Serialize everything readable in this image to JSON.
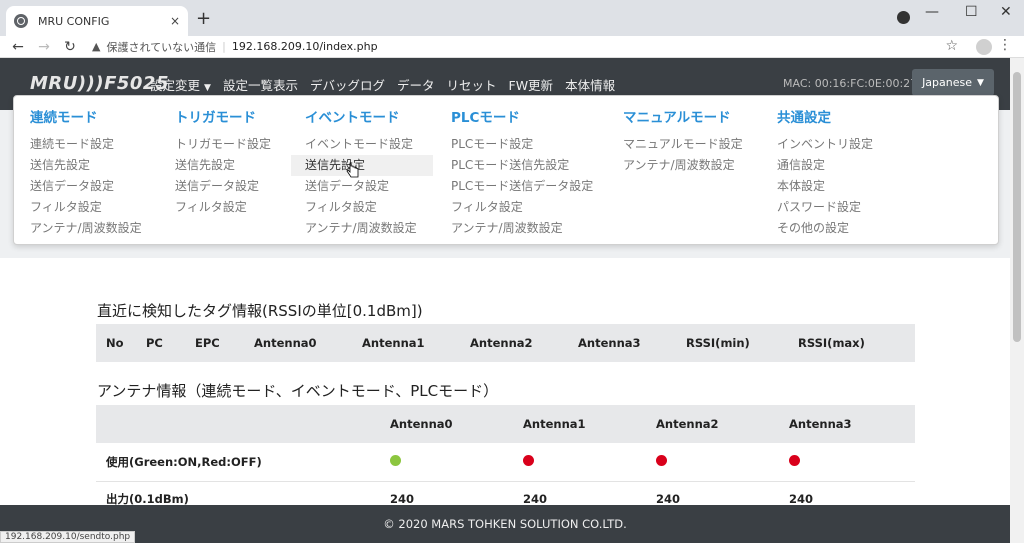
{
  "browser": {
    "tab_title": "MRU CONFIG",
    "tab_close": "×",
    "new_tab": "+",
    "security_label": "保護されていない通信",
    "url": "192.168.209.10/index.php",
    "status_url": "192.168.209.10/sendto.php"
  },
  "navbar": {
    "brand": "MRU)))F5025",
    "menu": [
      {
        "label": "設定変更"
      },
      {
        "label": "設定一覧表示"
      },
      {
        "label": "デバッグログ"
      },
      {
        "label": "データ"
      },
      {
        "label": "リセット"
      },
      {
        "label": "FW更新"
      },
      {
        "label": "本体情報"
      }
    ],
    "mac": "MAC: 00:16:FC:0E:00:27",
    "language": "Japanese"
  },
  "dropdown": {
    "columns": [
      {
        "head": "連続モード",
        "items": [
          "連続モード設定",
          "送信先設定",
          "送信データ設定",
          "フィルタ設定",
          "アンテナ/周波数設定"
        ]
      },
      {
        "head": "トリガモード",
        "items": [
          "トリガモード設定",
          "送信先設定",
          "送信データ設定",
          "フィルタ設定"
        ]
      },
      {
        "head": "イベントモード",
        "items": [
          "イベントモード設定",
          "送信先設定",
          "送信データ設定",
          "フィルタ設定",
          "アンテナ/周波数設定"
        ]
      },
      {
        "head": "PLCモード",
        "items": [
          "PLCモード設定",
          "PLCモード送信先設定",
          "PLCモード送信データ設定",
          "フィルタ設定",
          "アンテナ/周波数設定"
        ]
      },
      {
        "head": "マニュアルモード",
        "items": [
          "マニュアルモード設定",
          "アンテナ/周波数設定"
        ]
      },
      {
        "head": "共通設定",
        "items": [
          "インベントリ設定",
          "通信設定",
          "本体設定",
          "パスワード設定",
          "その他の設定"
        ]
      }
    ]
  },
  "tag_section": {
    "title": "直近に検知したタグ情報(RSSIの単位[0.1dBm])",
    "headers": [
      "No",
      "PC",
      "EPC",
      "Antenna0",
      "Antenna1",
      "Antenna2",
      "Antenna3",
      "RSSI(min)",
      "RSSI(max)"
    ]
  },
  "antenna_section": {
    "title": "アンテナ情報（連続モード、イベントモード、PLCモード）",
    "headers": [
      "",
      "Antenna0",
      "Antenna1",
      "Antenna2",
      "Antenna3"
    ],
    "rows": [
      {
        "label": "使用(Green:ON,Red:OFF)",
        "status": [
          "on",
          "off",
          "off",
          "off"
        ]
      },
      {
        "label": "出力(0.1dBm)",
        "values": [
          "240",
          "240",
          "240",
          "240"
        ]
      }
    ],
    "colors": {
      "on": "#8cc63f",
      "off": "#d9001b"
    }
  },
  "footer": {
    "text": "© 2020 MARS TOHKEN SOLUTION CO.LTD."
  }
}
